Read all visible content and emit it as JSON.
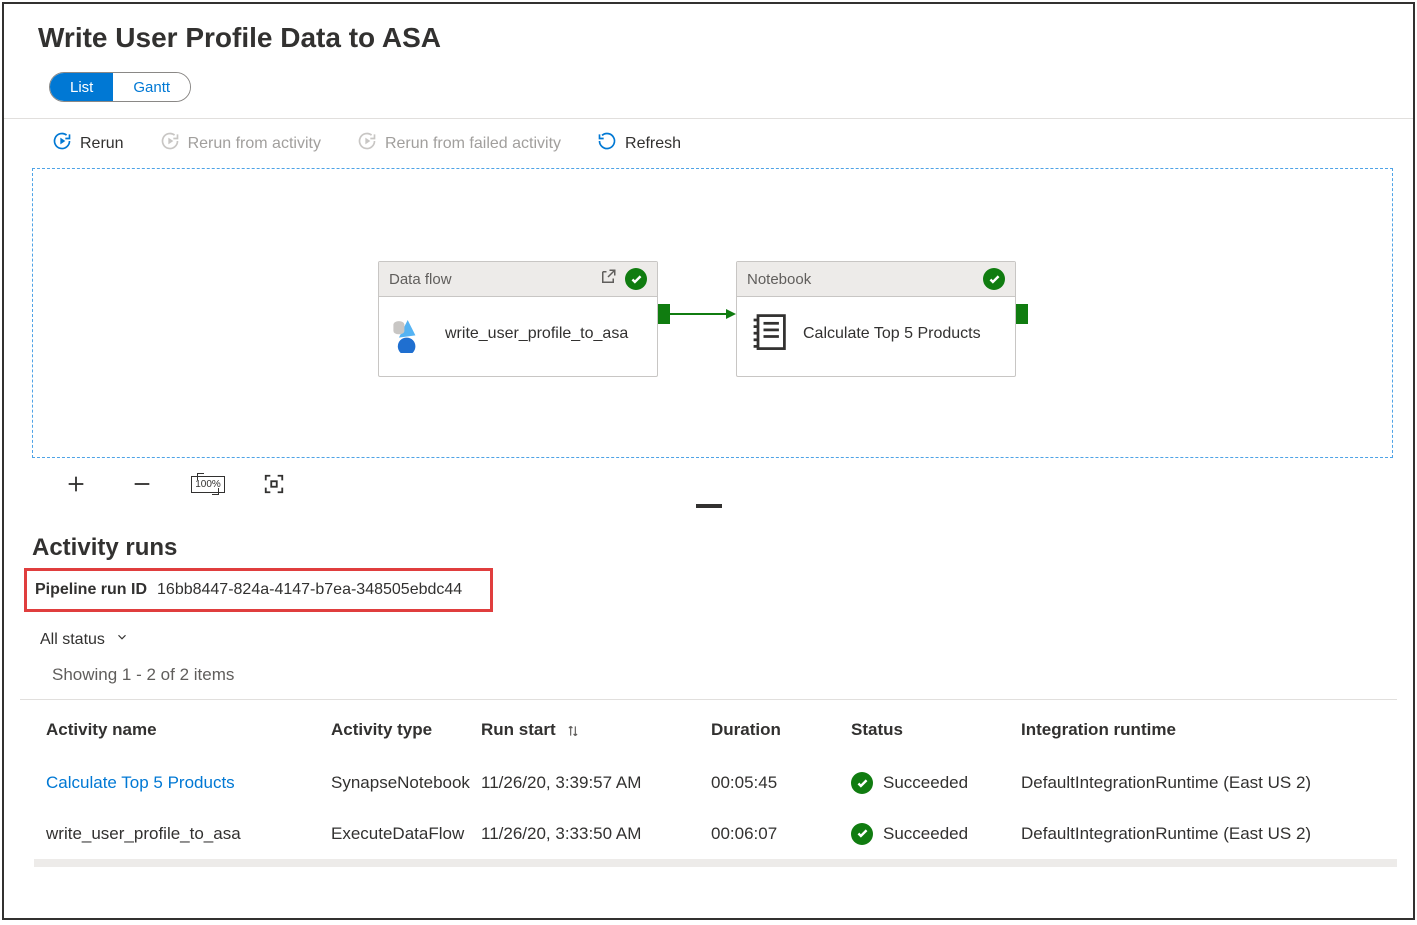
{
  "header": {
    "title": "Write User Profile Data to ASA"
  },
  "viewToggle": {
    "list": "List",
    "gantt": "Gantt",
    "active": "list"
  },
  "toolbar": {
    "rerun": "Rerun",
    "rerun_from_activity": "Rerun from activity",
    "rerun_from_failed": "Rerun from failed activity",
    "refresh": "Refresh"
  },
  "canvas": {
    "zoom_label": "100%",
    "activities": {
      "dataflow": {
        "type_label": "Data flow",
        "name": "write_user_profile_to_asa",
        "status": "Succeeded"
      },
      "notebook": {
        "type_label": "Notebook",
        "name": "Calculate Top 5 Products",
        "status": "Succeeded"
      }
    }
  },
  "activityRuns": {
    "section_title": "Activity runs",
    "pipeline_run_id_label": "Pipeline run ID",
    "pipeline_run_id": "16bb8447-824a-4147-b7ea-348505ebdc44",
    "filter_label": "All status",
    "showing_text": "Showing 1 - 2 of 2 items",
    "columns": {
      "name": "Activity name",
      "type": "Activity type",
      "start": "Run start",
      "duration": "Duration",
      "status": "Status",
      "runtime": "Integration runtime"
    },
    "rows": [
      {
        "name": "Calculate Top 5 Products",
        "is_link": true,
        "type": "SynapseNotebook",
        "start": "11/26/20, 3:39:57 AM",
        "duration": "00:05:45",
        "status": "Succeeded",
        "runtime": "DefaultIntegrationRuntime (East US 2)"
      },
      {
        "name": "write_user_profile_to_asa",
        "is_link": false,
        "type": "ExecuteDataFlow",
        "start": "11/26/20, 3:33:50 AM",
        "duration": "00:06:07",
        "status": "Succeeded",
        "runtime": "DefaultIntegrationRuntime (East US 2)"
      }
    ]
  }
}
